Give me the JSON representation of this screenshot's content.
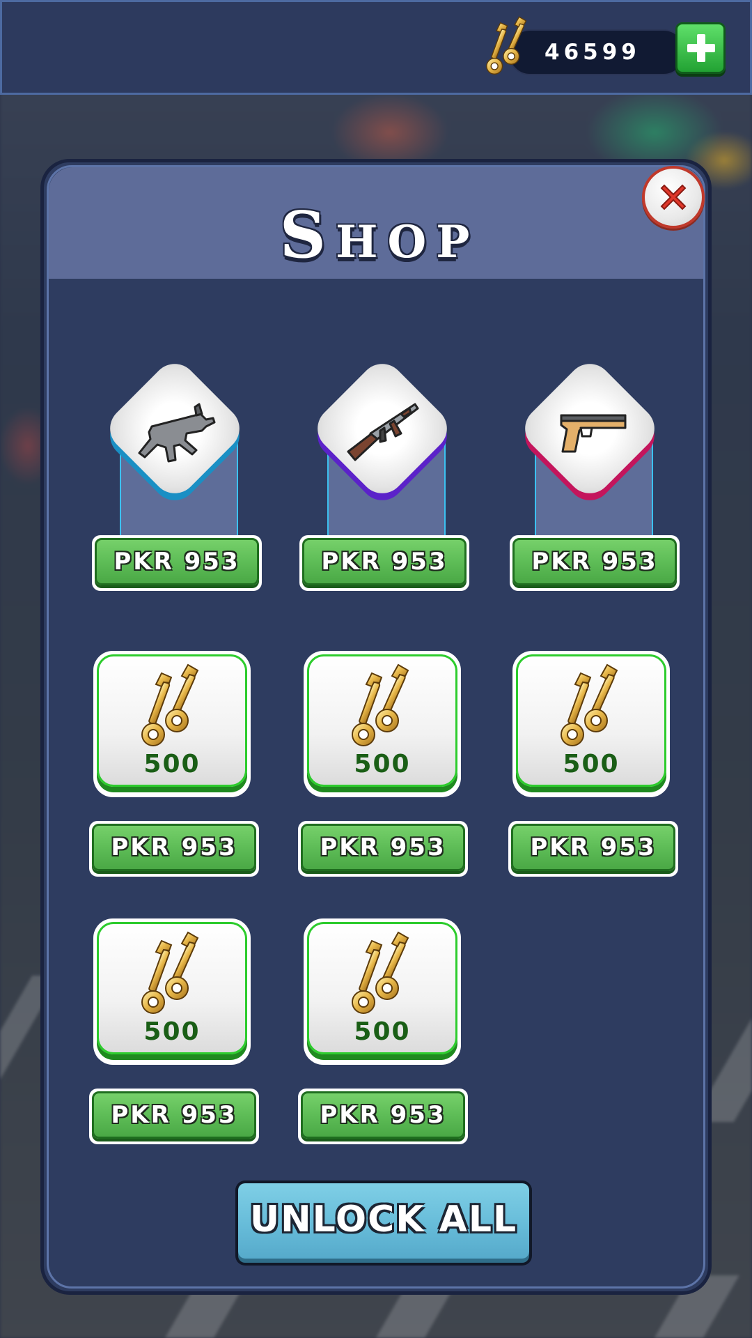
{
  "currency": {
    "icon": "keys-icon",
    "amount": "46599",
    "add_icon": "plus-icon"
  },
  "panel": {
    "title": "Shop",
    "close_icon": "close-icon"
  },
  "weapons": [
    {
      "icon": "smg-icon",
      "price": "PKR 953",
      "accent": "#1a8fc4"
    },
    {
      "icon": "assault-rifle-icon",
      "price": "PKR 953",
      "accent": "#5b22c9"
    },
    {
      "icon": "pistol-icon",
      "price": "PKR 953",
      "accent": "#c4155c"
    }
  ],
  "key_packs": [
    {
      "icon": "keys-icon",
      "amount": "500",
      "price": "PKR 953"
    },
    {
      "icon": "keys-icon",
      "amount": "500",
      "price": "PKR 953"
    },
    {
      "icon": "keys-icon",
      "amount": "500",
      "price": "PKR 953"
    },
    {
      "icon": "keys-icon",
      "amount": "500",
      "price": "PKR 953"
    },
    {
      "icon": "keys-icon",
      "amount": "500",
      "price": "PKR 953"
    }
  ],
  "unlock_all_label": "UNLOCK ALL"
}
